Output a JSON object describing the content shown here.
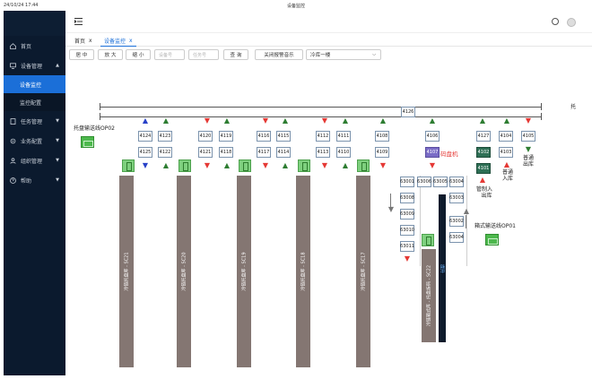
{
  "status_bar": {
    "time": "24/10/24 17:44",
    "title": "设备监控"
  },
  "sidebar": {
    "items": [
      {
        "label": "首页",
        "icon": "home-icon"
      },
      {
        "label": "设备管理",
        "icon": "monitor-icon",
        "chev": "▲"
      },
      {
        "label": "任务管理",
        "icon": "clipboard-icon",
        "chev": "▼"
      },
      {
        "label": "业务配置",
        "icon": "gear-icon",
        "chev": "▼"
      },
      {
        "label": "组织管理",
        "icon": "people-icon",
        "chev": "▼"
      },
      {
        "label": "帮助",
        "icon": "question-icon",
        "chev": "▼"
      }
    ],
    "subitems": [
      {
        "label": "设备监控",
        "active": true
      },
      {
        "label": "监控配置",
        "active": false
      }
    ]
  },
  "header": {
    "menu_icon": "menu-toggle-icon",
    "globe_icon": "globe-icon",
    "avatar_icon": "avatar-icon"
  },
  "tabs": [
    {
      "label": "首页",
      "close": "x"
    },
    {
      "label": "设备监控",
      "close": "x"
    }
  ],
  "toolbar": {
    "center": "居 中",
    "zoom_in": "放 大",
    "zoom_out": "缩 小",
    "device_placeholder": "设备号",
    "task_placeholder": "任务号",
    "query": "查 询",
    "mute": "关闭报警音乐",
    "location": "冷库一楼",
    "chev": "⌵"
  },
  "canvas": {
    "top_conveyor": "4126",
    "right_edge": "托",
    "pallet_line_label": "托盘输送线OP02",
    "box_line_label": "箱式输送线OP01",
    "coder_label": "码盘机",
    "lift_label": "提升",
    "boxes": {
      "b4124": "4124",
      "b4125": "4125",
      "b4123": "4123",
      "b4122": "4122",
      "b4120": "4120",
      "b4121": "4121",
      "b4119": "4119",
      "b4118": "4118",
      "b4116": "4116",
      "b4117": "4117",
      "b4115": "4115",
      "b4114": "4114",
      "b4112": "4112",
      "b4113": "4113",
      "b4111": "4111",
      "b4110": "4110",
      "b4108": "4108",
      "b4109": "4109",
      "b4106": "4106",
      "b4107": "4107",
      "b4127": "4127",
      "b4102": "4102",
      "b4101": "4101",
      "b4104": "4104",
      "b4103": "4103",
      "b4105": "4105",
      "b63001": "63001",
      "b63006": "63006",
      "b63005": "63005",
      "b63004": "63004",
      "b63008": "63008",
      "b63009": "63009",
      "b63010": "63010",
      "b63011": "63011",
      "b63003": "63003",
      "b63002": "63002",
      "b63004b": "63004"
    },
    "pillars": [
      "冷链托盘库 - SC21",
      "冷链托盘库 - SC20",
      "冷链托盘库 - SC19",
      "冷链托盘库 - SC18",
      "冷链托盘库 - SC17",
      "冷链箱式库 - 托盘拆码 - SC22"
    ],
    "out_labels": {
      "mgr_in": "管制入",
      "mgr_in2": "出库",
      "normal_in": "普通",
      "normal_in2": "入库",
      "normal_out": "普通",
      "normal_out2": "出库"
    }
  },
  "colors": {
    "sidebar_bg": "#0b1a2e",
    "accent": "#1b6fd8",
    "pillar": "#847672",
    "green": "#4db84d",
    "red_arrow": "#e53935",
    "green_arrow": "#2e7d32",
    "blue_arrow": "#2841c8"
  }
}
